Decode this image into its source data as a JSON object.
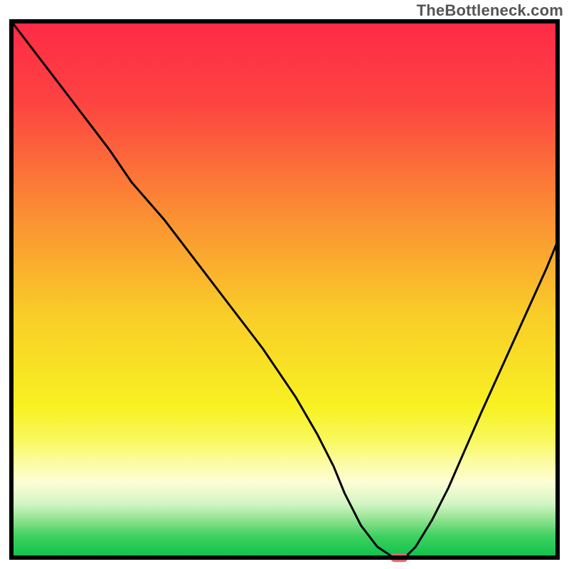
{
  "watermark": "TheBottleneck.com",
  "chart_data": {
    "type": "line",
    "title": "",
    "xlabel": "",
    "ylabel": "",
    "xlim": [
      0,
      100
    ],
    "ylim": [
      0,
      100
    ],
    "background_gradient": {
      "stops": [
        {
          "offset": 0.0,
          "color": "#fe2a47"
        },
        {
          "offset": 0.15,
          "color": "#fd4341"
        },
        {
          "offset": 0.35,
          "color": "#fb8b34"
        },
        {
          "offset": 0.55,
          "color": "#f9ce28"
        },
        {
          "offset": 0.72,
          "color": "#f8f122"
        },
        {
          "offset": 0.78,
          "color": "#f9f85c"
        },
        {
          "offset": 0.82,
          "color": "#fbfc9e"
        },
        {
          "offset": 0.86,
          "color": "#fdfed6"
        },
        {
          "offset": 0.9,
          "color": "#d2f5c3"
        },
        {
          "offset": 0.93,
          "color": "#8de28e"
        },
        {
          "offset": 0.96,
          "color": "#3ed060"
        },
        {
          "offset": 1.0,
          "color": "#0dc24a"
        }
      ]
    },
    "series": [
      {
        "name": "bottleneck-curve",
        "color": "#000000",
        "x": [
          0,
          6,
          12,
          18,
          22,
          28,
          34,
          40,
          46,
          52,
          56,
          59,
          61,
          64,
          67,
          70,
          72,
          74,
          77,
          80,
          83,
          86,
          90,
          94,
          98,
          100
        ],
        "y": [
          100,
          92,
          84,
          76,
          70,
          63,
          55,
          47,
          39,
          30,
          23,
          17,
          12,
          6,
          2,
          0,
          0,
          2,
          7,
          13,
          20,
          27,
          36,
          45,
          54,
          59
        ]
      }
    ],
    "marker": {
      "name": "optimal-point",
      "shape": "pill",
      "color": "#e36868",
      "cx": 71,
      "cy": 0,
      "width_pct": 3.2,
      "height_pct": 1.6
    },
    "axes": {
      "show_border": true,
      "border_color": "#000000",
      "border_width": 2
    }
  }
}
